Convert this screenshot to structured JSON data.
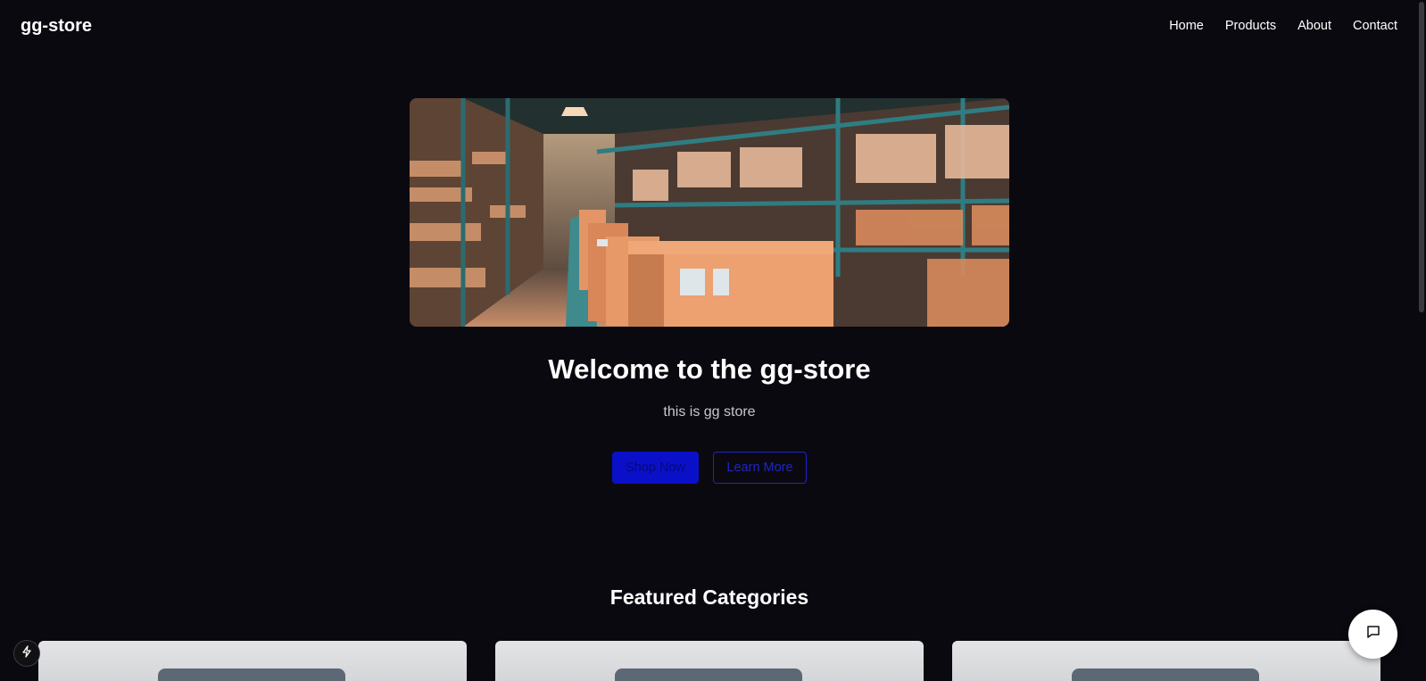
{
  "header": {
    "brand": "gg-store",
    "nav": [
      "Home",
      "Products",
      "About",
      "Contact"
    ]
  },
  "hero": {
    "title": "Welcome to the gg-store",
    "subtitle": "this is gg store",
    "primary_button": "Shop Now",
    "secondary_button": "Learn More"
  },
  "featured": {
    "title": "Featured Categories"
  },
  "icons": {
    "chat": "chat-bubble-icon",
    "dev": "lightning-icon"
  },
  "colors": {
    "background": "#0b0910",
    "primary": "#0a10c8",
    "text": "#ffffff"
  }
}
